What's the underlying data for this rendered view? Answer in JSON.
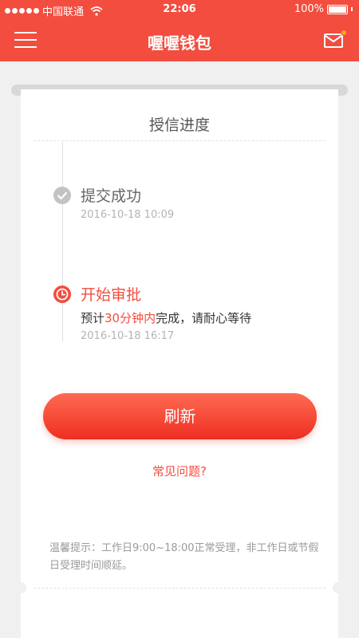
{
  "status_bar": {
    "carrier": "中国联通",
    "time": "22:06",
    "battery": "100%"
  },
  "header": {
    "title": "喔喔钱包"
  },
  "card": {
    "title": "授信进度",
    "steps": [
      {
        "title": "提交成功",
        "date": "2016-10-18 10:09",
        "state": "done"
      },
      {
        "title": "开始审批",
        "desc_before": "预计",
        "desc_highlight": "30分钟内",
        "desc_after": "完成，请耐心等待",
        "date": "2016-10-18 16:17",
        "state": "active"
      }
    ],
    "refresh_label": "刷新",
    "faq_label": "常见问题?",
    "tip_text": "温馨提示：工作日9:00~18:00正常受理，非工作日或节假日受理时间顺延。"
  },
  "colors": {
    "accent": "#f24d3f",
    "done": "#c3c3c3",
    "mail_badge": "#ffa21a"
  },
  "icons": [
    "menu-icon",
    "mail-icon",
    "check-icon",
    "clock-icon",
    "wifi-icon",
    "battery-icon"
  ]
}
